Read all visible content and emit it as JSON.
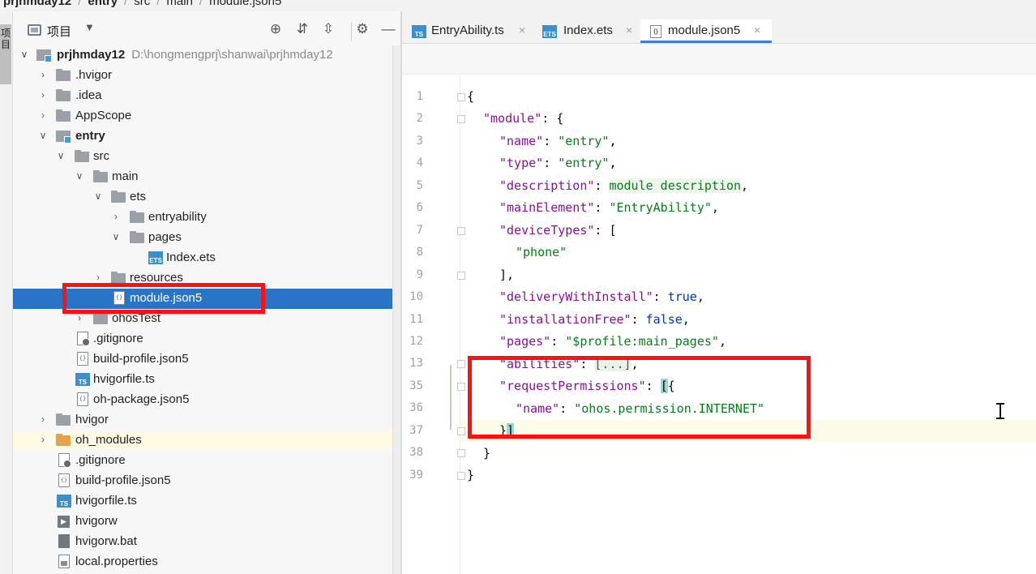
{
  "breadcrumb": {
    "items": [
      {
        "label": "prjhmday12"
      },
      {
        "label": "entry"
      },
      {
        "label": "src"
      },
      {
        "label": "main"
      },
      {
        "label": "module.json5"
      }
    ]
  },
  "tool_strip": {
    "project_tab": "项目"
  },
  "project_panel": {
    "title": "项目",
    "caret": "▼",
    "toolbar_icons": [
      "locate-icon",
      "expand-all-icon",
      "collapse-all-icon",
      "gear-icon",
      "minimize-icon"
    ],
    "toolbar_glyphs": {
      "locate": "⊕",
      "expand": "⇵",
      "collapse": "⇳",
      "gear": "⚙",
      "minimize": "—"
    },
    "tree": {
      "root_name": "prjhmday12",
      "root_path": "D:\\hongmengprj\\shanwai\\prjhmday12",
      "items": [
        {
          "label": ".hvigor"
        },
        {
          "label": ".idea"
        },
        {
          "label": "AppScope"
        },
        {
          "label": "entry"
        },
        {
          "label": "src"
        },
        {
          "label": "main"
        },
        {
          "label": "ets"
        },
        {
          "label": "entryability"
        },
        {
          "label": "pages"
        },
        {
          "label": "Index.ets"
        },
        {
          "label": "resources"
        },
        {
          "label": "module.json5"
        },
        {
          "label": "ohosTest"
        },
        {
          "label": ".gitignore"
        },
        {
          "label": "build-profile.json5"
        },
        {
          "label": "hvigorfile.ts"
        },
        {
          "label": "oh-package.json5"
        },
        {
          "label": "hvigor"
        },
        {
          "label": "oh_modules"
        },
        {
          "label": ".gitignore"
        },
        {
          "label": "build-profile.json5"
        },
        {
          "label": "hvigorfile.ts"
        },
        {
          "label": "hvigorw"
        },
        {
          "label": "hvigorw.bat"
        },
        {
          "label": "local.properties"
        }
      ]
    },
    "icon_text": {
      "ts": "TS",
      "ets": "ETS",
      "json": "{}",
      "exec": "▶"
    }
  },
  "editor": {
    "tabs": [
      {
        "label": "EntryAbility.ts",
        "icon": "TS"
      },
      {
        "label": "Index.ets",
        "icon": "ETS"
      },
      {
        "label": "module.json5",
        "icon": "{}"
      }
    ],
    "close_glyph": "×",
    "active_tab": "module.json5",
    "line_numbers": [
      "1",
      "2",
      "3",
      "4",
      "5",
      "6",
      "7",
      "8",
      "9",
      "10",
      "11",
      "12",
      "13",
      "35",
      "36",
      "37",
      "38",
      "39"
    ],
    "code": {
      "l1": "{",
      "l2_key": "\"module\"",
      "l2_rest": ": {",
      "l3_key": "\"name\"",
      "l3_val": "\"entry\"",
      "l4_key": "\"type\"",
      "l4_val": "\"entry\"",
      "l5_key": "\"description\"",
      "l5_val": "module description",
      "l6_key": "\"mainElement\"",
      "l6_val": "\"EntryAbility\"",
      "l7_key": "\"deviceTypes\"",
      "l7_rest": ": [",
      "l8_val": "\"phone\"",
      "l9": "],",
      "l10_key": "\"deliveryWithInstall\"",
      "l10_val": "true",
      "l11_key": "\"installationFree\"",
      "l11_val": "false",
      "l12_key": "\"pages\"",
      "l12_val": "\"$profile:main_pages\"",
      "l13_key": "\"abilities\"",
      "l13_val": "[...]",
      "l35_key": "\"requestPermissions\"",
      "l36_key": "\"name\"",
      "l36_val": "\"ohos.permission.INTERNET\"",
      "l37": "}]",
      "l38": "}",
      "l39": "}",
      "colon": ": ",
      "comma": ","
    }
  },
  "annotation_color": "#ff1111"
}
